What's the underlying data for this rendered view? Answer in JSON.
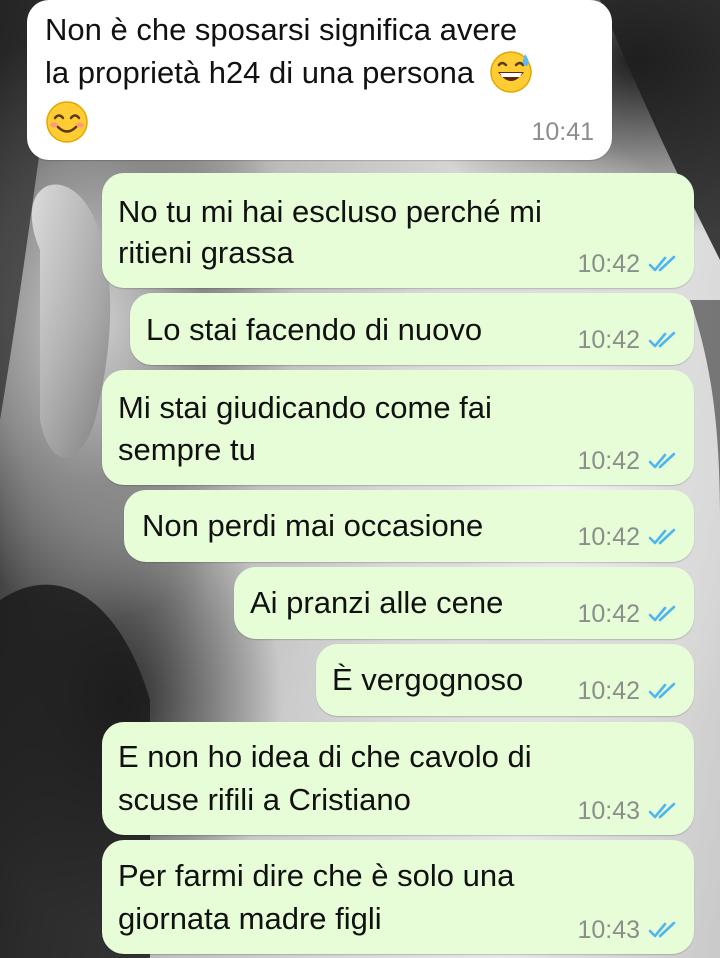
{
  "chat": {
    "messages": [
      {
        "direction": "incoming",
        "lines": [
          "Non è che sposarsi significa avere",
          "la proprietà h24 di una persona"
        ],
        "emojis": [
          "grinning-face-with-sweat-icon",
          "smiling-face-with-smiling-eyes-icon"
        ],
        "time": "10:41"
      },
      {
        "direction": "outgoing",
        "lines": [
          "No tu mi hai escluso perché mi",
          "ritieni grassa"
        ],
        "time": "10:42",
        "status": "read"
      },
      {
        "direction": "outgoing",
        "lines": [
          "Lo stai facendo di nuovo"
        ],
        "time": "10:42",
        "status": "read"
      },
      {
        "direction": "outgoing",
        "lines": [
          "Mi stai giudicando come fai",
          "sempre tu"
        ],
        "time": "10:42",
        "status": "read"
      },
      {
        "direction": "outgoing",
        "lines": [
          "Non perdi mai occasione"
        ],
        "time": "10:42",
        "status": "read"
      },
      {
        "direction": "outgoing",
        "lines": [
          "Ai pranzi alle cene"
        ],
        "time": "10:42",
        "status": "read"
      },
      {
        "direction": "outgoing",
        "lines": [
          "È vergognoso"
        ],
        "time": "10:42",
        "status": "read"
      },
      {
        "direction": "outgoing",
        "lines": [
          "E non ho idea di che cavolo di",
          "scuse rifili a Cristiano"
        ],
        "time": "10:43",
        "status": "read"
      },
      {
        "direction": "outgoing",
        "lines": [
          "Per farmi dire che è solo una",
          "giornata madre figli"
        ],
        "time": "10:43",
        "status": "read"
      }
    ]
  },
  "colors": {
    "incoming_bubble": "#ffffff",
    "outgoing_bubble": "#e7fdd8",
    "read_tick": "#4fb6ec",
    "timestamp": "#8a8f8a"
  }
}
